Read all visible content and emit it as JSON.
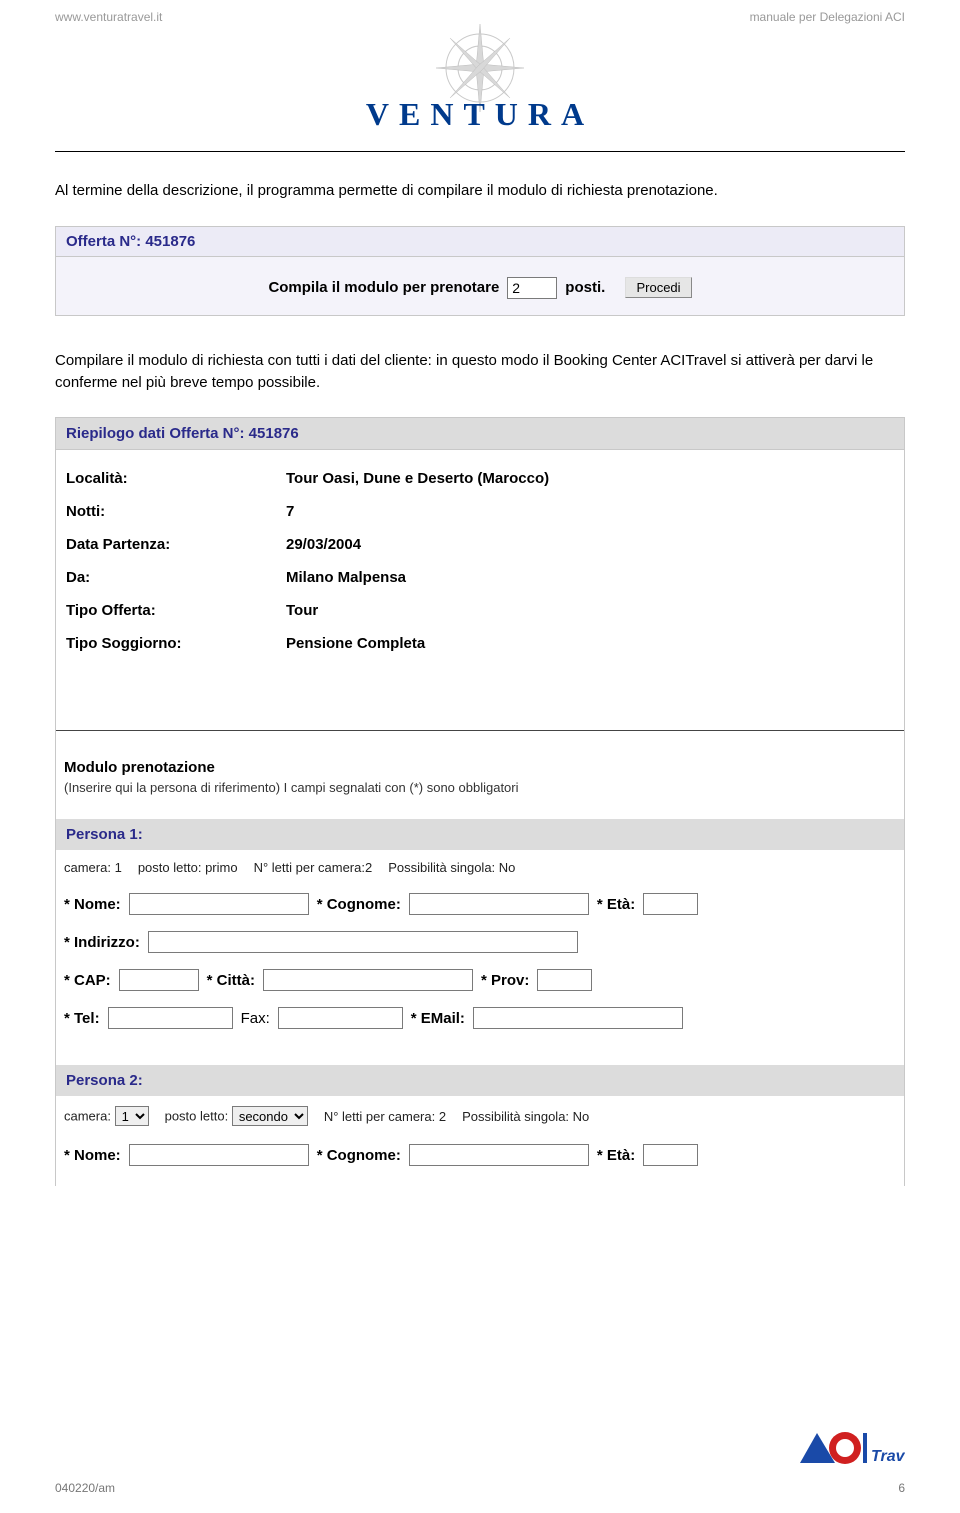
{
  "header": {
    "left": "www.venturatravel.it",
    "right": "manuale per Delegazioni ACI",
    "brand": "VENTURA"
  },
  "para1": "Al termine della descrizione, il programma permette di compilare il modulo di richiesta prenotazione.",
  "para2": "Compilare  il modulo di richiesta con tutti i dati del cliente: in questo modo il Booking Center ACITravel si attiverà per darvi le conferme nel più breve tempo possibile.",
  "offer": {
    "title": "Offerta N°: 451876",
    "compose_text_pre": "Compila il modulo per prenotare",
    "posti_value": "2",
    "compose_text_post": "posti.",
    "procedi": "Procedi"
  },
  "summary": {
    "title": "Riepilogo dati Offerta N°: 451876",
    "rows": [
      {
        "label": "Località:",
        "value": "Tour Oasi, Dune e Deserto (Marocco)"
      },
      {
        "label": "Notti:",
        "value": "7"
      },
      {
        "label": "Data Partenza:",
        "value": "29/03/2004"
      },
      {
        "label": "Da:",
        "value": "Milano Malpensa"
      },
      {
        "label": "Tipo Offerta:",
        "value": "Tour"
      },
      {
        "label": "Tipo Soggiorno:",
        "value": "Pensione Completa"
      }
    ]
  },
  "module": {
    "title": "Modulo prenotazione",
    "subtitle": "(Inserire qui la persona di riferimento)   I campi segnalati con (*) sono obbligatori"
  },
  "person1": {
    "title": "Persona 1:",
    "camera_l": "camera:",
    "camera_v": "1",
    "posto_l": "posto letto:",
    "posto_v": "primo",
    "letti_l": "N° letti per camera:",
    "letti_v": "2",
    "singola_l": "Possibilità singola:",
    "singola_v": "No",
    "nome_l": "* Nome:",
    "cognome_l": "* Cognome:",
    "eta_l": "* Età:",
    "indirizzo_l": "* Indirizzo:",
    "cap_l": "* CAP:",
    "citta_l": "* Città:",
    "prov_l": "* Prov:",
    "tel_l": "* Tel:",
    "fax_l": "Fax:",
    "email_l": "* EMail:"
  },
  "person2": {
    "title": "Persona 2:",
    "camera_l": "camera:",
    "camera_opt": "1",
    "posto_l": "posto letto:",
    "posto_opt": "secondo",
    "letti_l": "N° letti per camera:",
    "letti_v": "2",
    "singola_l": "Possibilità singola:",
    "singola_v": "No",
    "nome_l": "* Nome:",
    "cognome_l": "* Cognome:",
    "eta_l": "* Età:"
  },
  "footer": {
    "left": "040220/am",
    "logo_text": "Travel",
    "page": "6"
  }
}
